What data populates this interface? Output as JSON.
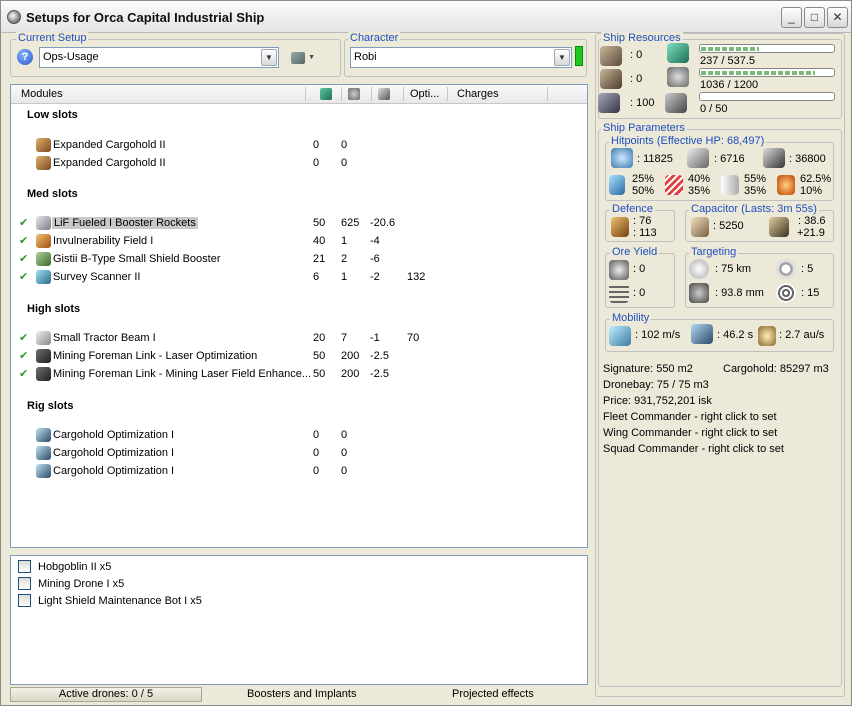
{
  "window": {
    "title": "Setups for Orca Capital Industrial Ship",
    "minimize": "_",
    "maximize": "□",
    "close": "✕"
  },
  "current_setup": {
    "legend": "Current Setup",
    "value": "Ops-Usage"
  },
  "character": {
    "legend": "Character",
    "value": "Robi"
  },
  "modules_header": {
    "modules": "Modules",
    "optimal": "Opti...",
    "charges": "Charges"
  },
  "sections": {
    "low": "Low slots",
    "med": "Med slots",
    "high": "High slots",
    "rig": "Rig slots"
  },
  "low_slots": [
    {
      "name": "Expanded Cargohold II",
      "c1": "0",
      "c2": "0"
    },
    {
      "name": "Expanded Cargohold II",
      "c1": "0",
      "c2": "0"
    }
  ],
  "med_slots": [
    {
      "name": "LiF Fueled I Booster Rockets",
      "c1": "50",
      "c2": "625",
      "c3": "-20.6",
      "c4": ""
    },
    {
      "name": "Invulnerability Field I",
      "c1": "40",
      "c2": "1",
      "c3": "-4",
      "c4": ""
    },
    {
      "name": "Gistii B-Type Small Shield Booster",
      "c1": "21",
      "c2": "2",
      "c3": "-6",
      "c4": ""
    },
    {
      "name": "Survey Scanner II",
      "c1": "6",
      "c2": "1",
      "c3": "-2",
      "c4": "132"
    }
  ],
  "high_slots": [
    {
      "name": "Small Tractor Beam I",
      "c1": "20",
      "c2": "7",
      "c3": "-1",
      "c4": "70"
    },
    {
      "name": "Mining Foreman Link - Laser Optimization",
      "c1": "50",
      "c2": "200",
      "c3": "-2.5",
      "c4": ""
    },
    {
      "name": "Mining Foreman Link - Mining Laser Field Enhance...",
      "c1": "50",
      "c2": "200",
      "c3": "-2.5",
      "c4": ""
    }
  ],
  "rig_slots": [
    {
      "name": "Cargohold Optimization I",
      "c1": "0",
      "c2": "0"
    },
    {
      "name": "Cargohold Optimization I",
      "c1": "0",
      "c2": "0"
    },
    {
      "name": "Cargohold Optimization I",
      "c1": "0",
      "c2": "0"
    }
  ],
  "drones": [
    "Hobgoblin II x5",
    "Mining Drone I x5",
    "Light Shield Maintenance Bot I x5"
  ],
  "status": {
    "active_drones": "Active drones: 0 / 5",
    "boosters": "Boosters and Implants",
    "projected": "Projected effects"
  },
  "ship_resources": {
    "legend": "Ship Resources",
    "turret": ": 0",
    "launcher": ": 0",
    "calibration": ": 100",
    "cpu": "237 / 537.5",
    "cpu_fraction": 0.44,
    "powergrid": "1036 / 1200",
    "powergrid_fraction": 0.86,
    "dronebay": "0 / 50",
    "dronebay_fraction": 0.0
  },
  "ship_parameters": {
    "legend": "Ship Parameters",
    "hitpoints_legend": "Hitpoints (Effective HP: 68,497)",
    "shield_hp": ": 11825",
    "armor_hp": ": 6716",
    "structure_hp": ": 36800",
    "res_em": [
      "25%",
      "50%"
    ],
    "res_thermal": [
      "40%",
      "35%"
    ],
    "res_kinetic": [
      "55%",
      "35%"
    ],
    "res_explosive": [
      "62.5%",
      "10%"
    ],
    "defence_legend": "Defence",
    "defence_a": ": 76",
    "defence_b": ": 113",
    "capacitor_legend": "Capacitor (Lasts: 3m 55s)",
    "capacitor": ": 5250",
    "cap_a": ": 38.6",
    "cap_b": "+21.9",
    "ore_legend": "Ore Yield",
    "ore_a": ": 0",
    "ore_b": ": 0",
    "targeting_legend": "Targeting",
    "target_range": ": 75 km",
    "max_targets": ": 5",
    "scan_res": ": 93.8 mm",
    "sensor": ": 15",
    "mobility_legend": "Mobility",
    "speed": ": 102 m/s",
    "agility": ": 46.2 s",
    "warp": ": 2.7 au/s"
  },
  "info": {
    "signature": "Signature: 550 m2",
    "cargohold": "Cargohold: 85297 m3",
    "dronebay": "Dronebay: 75 / 75 m3",
    "price": "Price: 931,752,201 isk",
    "fleet": "Fleet Commander - right click to set",
    "wing": "Wing Commander - right click to set",
    "squad": "Squad Commander - right click to set"
  }
}
